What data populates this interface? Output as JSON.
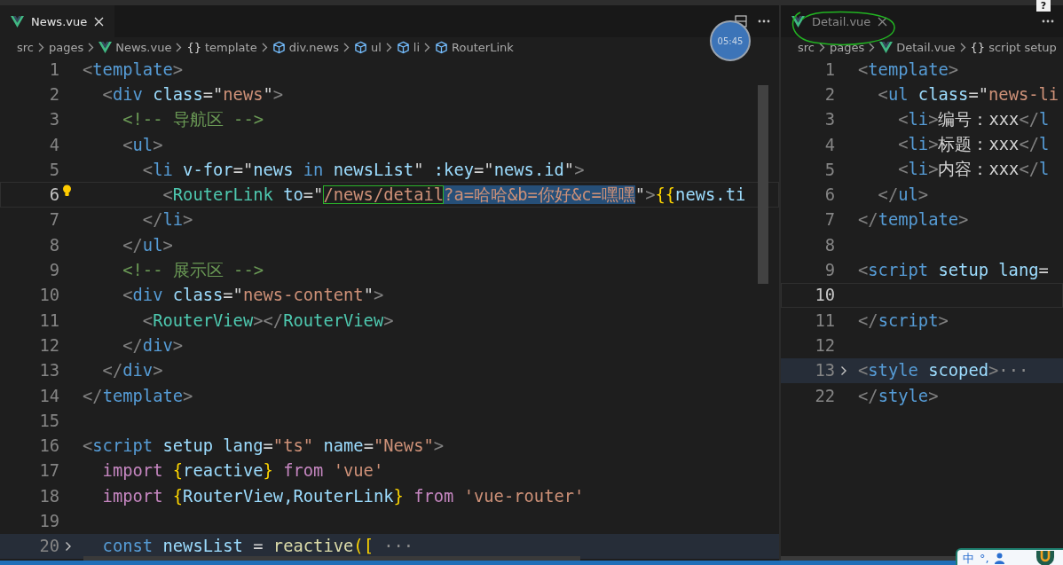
{
  "panes": [
    {
      "tabs": [
        {
          "label": "News.vue",
          "selected": true
        }
      ],
      "breadcrumbs": [
        {
          "kind": "folder",
          "text": "src"
        },
        {
          "kind": "folder",
          "text": "pages"
        },
        {
          "kind": "vue",
          "text": "News.vue"
        },
        {
          "kind": "braces",
          "icon": "{}",
          "text": "template"
        },
        {
          "kind": "element",
          "text": "div.news"
        },
        {
          "kind": "element",
          "text": "ul"
        },
        {
          "kind": "element",
          "text": "li"
        },
        {
          "kind": "element",
          "text": "RouterLink"
        }
      ],
      "lines": [
        {
          "number": "1",
          "current": false,
          "folded": false,
          "lightbulb": false,
          "tokens": [
            {
              "kind": "punct",
              "text": "<"
            },
            {
              "kind": "tag",
              "text": "template"
            },
            {
              "kind": "punct",
              "text": ">"
            }
          ]
        },
        {
          "number": "2",
          "current": false,
          "folded": false,
          "lightbulb": false,
          "tokens": [
            {
              "kind": "punct",
              "text": "  <"
            },
            {
              "kind": "tag",
              "text": "div"
            },
            {
              "kind": "attr",
              "text": " class"
            },
            {
              "kind": "text",
              "text": "=\""
            },
            {
              "kind": "string",
              "text": "news"
            },
            {
              "kind": "text",
              "text": "\""
            },
            {
              "kind": "punct",
              "text": ">"
            }
          ]
        },
        {
          "number": "3",
          "current": false,
          "folded": false,
          "lightbulb": false,
          "tokens": [
            {
              "kind": "comment",
              "text": "    <!-- 导航区 -->"
            }
          ]
        },
        {
          "number": "4",
          "current": false,
          "folded": false,
          "lightbulb": false,
          "tokens": [
            {
              "kind": "punct",
              "text": "    <"
            },
            {
              "kind": "tag",
              "text": "ul"
            },
            {
              "kind": "punct",
              "text": ">"
            }
          ]
        },
        {
          "number": "5",
          "current": false,
          "folded": false,
          "lightbulb": false,
          "tokens": [
            {
              "kind": "punct",
              "text": "      <"
            },
            {
              "kind": "tag",
              "text": "li"
            },
            {
              "kind": "attr",
              "text": " v-for"
            },
            {
              "kind": "text",
              "text": "=\""
            },
            {
              "kind": "variable",
              "text": "news"
            },
            {
              "kind": "tag",
              "text": " in "
            },
            {
              "kind": "variable",
              "text": "newsList"
            },
            {
              "kind": "text",
              "text": "\""
            },
            {
              "kind": "attr",
              "text": " :key"
            },
            {
              "kind": "text",
              "text": "=\""
            },
            {
              "kind": "variable",
              "text": "news.id"
            },
            {
              "kind": "text",
              "text": "\""
            },
            {
              "kind": "punct",
              "text": ">"
            }
          ]
        },
        {
          "number": "6",
          "current": true,
          "folded": false,
          "lightbulb": true,
          "tokens": [
            {
              "kind": "punct",
              "text": "        <"
            },
            {
              "kind": "component",
              "text": "RouterLink"
            },
            {
              "kind": "attr",
              "text": " to"
            },
            {
              "kind": "text",
              "text": "=\""
            },
            {
              "kind": "boxed-string",
              "text": "/news/detail"
            },
            {
              "kind": "selected-string",
              "text": "?a=哈哈&b=你好&c=嘿嘿"
            },
            {
              "kind": "text",
              "text": "\""
            },
            {
              "kind": "punct",
              "text": ">"
            },
            {
              "kind": "brace",
              "text": "{{"
            },
            {
              "kind": "variable",
              "text": "news.ti"
            }
          ]
        },
        {
          "number": "7",
          "current": false,
          "folded": false,
          "lightbulb": false,
          "tokens": [
            {
              "kind": "punct",
              "text": "      </"
            },
            {
              "kind": "tag",
              "text": "li"
            },
            {
              "kind": "punct",
              "text": ">"
            }
          ]
        },
        {
          "number": "8",
          "current": false,
          "folded": false,
          "lightbulb": false,
          "tokens": [
            {
              "kind": "punct",
              "text": "    </"
            },
            {
              "kind": "tag",
              "text": "ul"
            },
            {
              "kind": "punct",
              "text": ">"
            }
          ]
        },
        {
          "number": "9",
          "current": false,
          "folded": false,
          "lightbulb": false,
          "tokens": [
            {
              "kind": "comment",
              "text": "    <!-- 展示区 -->"
            }
          ]
        },
        {
          "number": "10",
          "current": false,
          "folded": false,
          "lightbulb": false,
          "tokens": [
            {
              "kind": "punct",
              "text": "    <"
            },
            {
              "kind": "tag",
              "text": "div"
            },
            {
              "kind": "attr",
              "text": " class"
            },
            {
              "kind": "text",
              "text": "=\""
            },
            {
              "kind": "string",
              "text": "news-content"
            },
            {
              "kind": "text",
              "text": "\""
            },
            {
              "kind": "punct",
              "text": ">"
            }
          ]
        },
        {
          "number": "11",
          "current": false,
          "folded": false,
          "lightbulb": false,
          "tokens": [
            {
              "kind": "punct",
              "text": "      <"
            },
            {
              "kind": "component",
              "text": "RouterView"
            },
            {
              "kind": "punct",
              "text": "></"
            },
            {
              "kind": "component",
              "text": "RouterView"
            },
            {
              "kind": "punct",
              "text": ">"
            }
          ]
        },
        {
          "number": "12",
          "current": false,
          "folded": false,
          "lightbulb": false,
          "tokens": [
            {
              "kind": "punct",
              "text": "    </"
            },
            {
              "kind": "tag",
              "text": "div"
            },
            {
              "kind": "punct",
              "text": ">"
            }
          ]
        },
        {
          "number": "13",
          "current": false,
          "folded": false,
          "lightbulb": false,
          "tokens": [
            {
              "kind": "punct",
              "text": "  </"
            },
            {
              "kind": "tag",
              "text": "div"
            },
            {
              "kind": "punct",
              "text": ">"
            }
          ]
        },
        {
          "number": "14",
          "current": false,
          "folded": false,
          "lightbulb": false,
          "tokens": [
            {
              "kind": "punct",
              "text": "</"
            },
            {
              "kind": "tag",
              "text": "template"
            },
            {
              "kind": "punct",
              "text": ">"
            }
          ]
        },
        {
          "number": "15",
          "current": false,
          "folded": false,
          "lightbulb": false
        },
        {
          "number": "16",
          "current": false,
          "folded": false,
          "lightbulb": false,
          "tokens": [
            {
              "kind": "punct",
              "text": "<"
            },
            {
              "kind": "tag",
              "text": "script"
            },
            {
              "kind": "attr",
              "text": " setup lang"
            },
            {
              "kind": "text",
              "text": "="
            },
            {
              "kind": "string",
              "text": "\"ts\""
            },
            {
              "kind": "attr",
              "text": " name"
            },
            {
              "kind": "text",
              "text": "="
            },
            {
              "kind": "string",
              "text": "\"News\""
            },
            {
              "kind": "punct",
              "text": ">"
            }
          ]
        },
        {
          "number": "17",
          "current": false,
          "folded": false,
          "lightbulb": false,
          "tokens": [
            {
              "kind": "keyword",
              "text": "  import "
            },
            {
              "kind": "brace",
              "text": "{"
            },
            {
              "kind": "variable",
              "text": "reactive"
            },
            {
              "kind": "brace",
              "text": "}"
            },
            {
              "kind": "keyword",
              "text": " from "
            },
            {
              "kind": "string",
              "text": "'vue'"
            }
          ]
        },
        {
          "number": "18",
          "current": false,
          "folded": false,
          "lightbulb": false,
          "tokens": [
            {
              "kind": "keyword",
              "text": "  import "
            },
            {
              "kind": "brace",
              "text": "{"
            },
            {
              "kind": "variable",
              "text": "RouterView,RouterLink"
            },
            {
              "kind": "brace",
              "text": "}"
            },
            {
              "kind": "keyword",
              "text": " from "
            },
            {
              "kind": "string",
              "text": "'vue-router'"
            }
          ]
        },
        {
          "number": "19",
          "current": false,
          "folded": false,
          "lightbulb": false
        },
        {
          "number": "20",
          "current": false,
          "folded": true,
          "lightbulb": false,
          "tokens": [
            {
              "kind": "tag",
              "text": "  const "
            },
            {
              "kind": "variable",
              "text": "newsList"
            },
            {
              "kind": "text",
              "text": " = "
            },
            {
              "kind": "function",
              "text": "reactive"
            },
            {
              "kind": "brace",
              "text": "(["
            },
            {
              "kind": "ellipsis",
              "text": " ···"
            }
          ]
        }
      ]
    },
    {
      "tabs": [
        {
          "label": "Detail.vue",
          "selected": false
        }
      ],
      "breadcrumbs": [
        {
          "kind": "folder",
          "text": "src"
        },
        {
          "kind": "folder",
          "text": "pages"
        },
        {
          "kind": "vue",
          "text": "Detail.vue"
        },
        {
          "kind": "braces",
          "icon": "{}",
          "text": "script setup"
        }
      ],
      "lines": [
        {
          "number": "1",
          "current": false,
          "folded": false,
          "lightbulb": false,
          "tokens": [
            {
              "kind": "punct",
              "text": "<"
            },
            {
              "kind": "tag",
              "text": "template"
            },
            {
              "kind": "punct",
              "text": ">"
            }
          ]
        },
        {
          "number": "2",
          "current": false,
          "folded": false,
          "lightbulb": false,
          "tokens": [
            {
              "kind": "punct",
              "text": "  <"
            },
            {
              "kind": "tag",
              "text": "ul"
            },
            {
              "kind": "attr",
              "text": " class"
            },
            {
              "kind": "text",
              "text": "=\""
            },
            {
              "kind": "string",
              "text": "news-li"
            }
          ]
        },
        {
          "number": "3",
          "current": false,
          "folded": false,
          "lightbulb": false,
          "tokens": [
            {
              "kind": "punct",
              "text": "    <"
            },
            {
              "kind": "tag",
              "text": "li"
            },
            {
              "kind": "punct",
              "text": ">"
            },
            {
              "kind": "text",
              "text": "编号：xxx"
            },
            {
              "kind": "punct",
              "text": "</"
            },
            {
              "kind": "tag",
              "text": "l"
            }
          ]
        },
        {
          "number": "4",
          "current": false,
          "folded": false,
          "lightbulb": false,
          "tokens": [
            {
              "kind": "punct",
              "text": "    <"
            },
            {
              "kind": "tag",
              "text": "li"
            },
            {
              "kind": "punct",
              "text": ">"
            },
            {
              "kind": "text",
              "text": "标题：xxx"
            },
            {
              "kind": "punct",
              "text": "</"
            },
            {
              "kind": "tag",
              "text": "l"
            }
          ]
        },
        {
          "number": "5",
          "current": false,
          "folded": false,
          "lightbulb": false,
          "tokens": [
            {
              "kind": "punct",
              "text": "    <"
            },
            {
              "kind": "tag",
              "text": "li"
            },
            {
              "kind": "punct",
              "text": ">"
            },
            {
              "kind": "text",
              "text": "内容：xxx"
            },
            {
              "kind": "punct",
              "text": "</"
            },
            {
              "kind": "tag",
              "text": "l"
            }
          ]
        },
        {
          "number": "6",
          "current": false,
          "folded": false,
          "lightbulb": false,
          "tokens": [
            {
              "kind": "punct",
              "text": "  </"
            },
            {
              "kind": "tag",
              "text": "ul"
            },
            {
              "kind": "punct",
              "text": ">"
            }
          ]
        },
        {
          "number": "7",
          "current": false,
          "folded": false,
          "lightbulb": false,
          "tokens": [
            {
              "kind": "punct",
              "text": "</"
            },
            {
              "kind": "tag",
              "text": "template"
            },
            {
              "kind": "punct",
              "text": ">"
            }
          ]
        },
        {
          "number": "8",
          "current": false,
          "folded": false,
          "lightbulb": false
        },
        {
          "number": "9",
          "current": false,
          "folded": false,
          "lightbulb": false,
          "tokens": [
            {
              "kind": "punct",
              "text": "<"
            },
            {
              "kind": "tag",
              "text": "script"
            },
            {
              "kind": "attr",
              "text": " setup lang"
            },
            {
              "kind": "text",
              "text": "="
            }
          ]
        },
        {
          "number": "10",
          "current": true,
          "folded": false,
          "lightbulb": false
        },
        {
          "number": "11",
          "current": false,
          "folded": false,
          "lightbulb": false,
          "tokens": [
            {
              "kind": "punct",
              "text": "</"
            },
            {
              "kind": "tag",
              "text": "script"
            },
            {
              "kind": "punct",
              "text": ">"
            }
          ]
        },
        {
          "number": "12",
          "current": false,
          "folded": false,
          "lightbulb": false
        },
        {
          "number": "13",
          "current": false,
          "folded": true,
          "lightbulb": false,
          "tokens": [
            {
              "kind": "punct",
              "text": "<"
            },
            {
              "kind": "tag",
              "text": "style"
            },
            {
              "kind": "attr",
              "text": " scoped"
            },
            {
              "kind": "punct",
              "text": ">"
            },
            {
              "kind": "ellipsis",
              "text": "···"
            }
          ]
        },
        {
          "number": "22",
          "current": false,
          "folded": false,
          "lightbulb": false,
          "tokens": [
            {
              "kind": "punct",
              "text": "</"
            },
            {
              "kind": "tag",
              "text": "style"
            },
            {
              "kind": "punct",
              "text": ">"
            }
          ]
        }
      ]
    }
  ],
  "timer": "05:45",
  "help": "?",
  "ime": {
    "mode": "中",
    "punctuation": "°,"
  }
}
